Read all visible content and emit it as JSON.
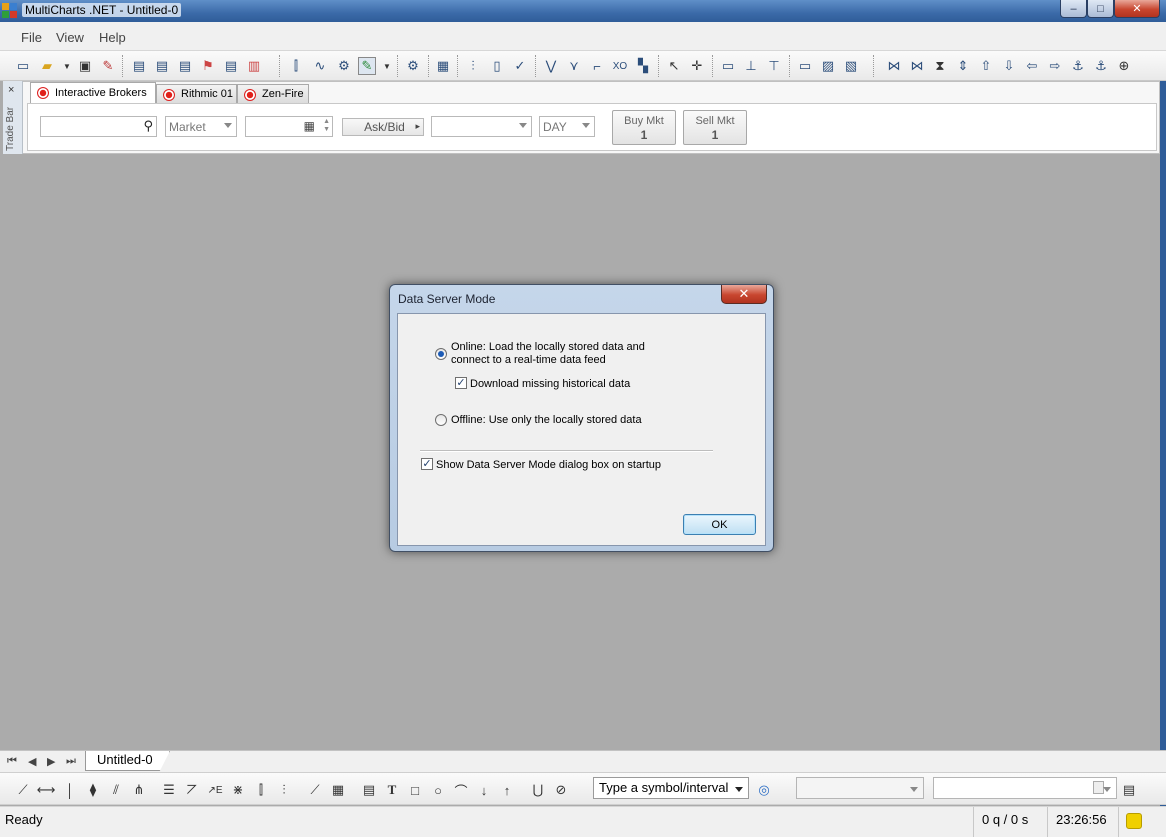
{
  "window": {
    "title": "MultiCharts .NET - Untitled-0",
    "controls": {
      "minimize": "–",
      "maximize": "□",
      "close": "✕"
    }
  },
  "menu": {
    "items": [
      "File",
      "View",
      "Help"
    ]
  },
  "toolbar": {
    "icons": [
      "new-window-icon",
      "open-folder-icon",
      "dropdown-arrow-icon",
      "save-icon",
      "edit-icon",
      "doc-a-icon",
      "doc-b-icon",
      "doc-c-icon",
      "run-icon",
      "doc-d-icon",
      "doc-e-icon",
      "bars-add-icon",
      "bars-curve-icon",
      "bars-settings-icon",
      "pencil-active-icon",
      "dropdown-arrow-icon",
      "formats-icon",
      "calendar-icon",
      "ohlc-icon",
      "candle-icon",
      "checkmark-icon",
      "line-chart-icon",
      "point-figure-icon",
      "step-icon",
      "xo-icon",
      "renko-icon",
      "cursor-icon",
      "crosshair-icon",
      "comment-icon",
      "lower-icon",
      "lift-icon",
      "window-icon",
      "picture-icon",
      "review-icon",
      "first-icon",
      "prev-icon",
      "hourglass-icon",
      "updown-icon",
      "up-icon",
      "down-icon",
      "left-icon",
      "right-icon",
      "anchor-up-icon",
      "anchor-down-icon",
      "zoom-icon"
    ]
  },
  "tradebar": {
    "side_label": "Trade Bar",
    "close": "×",
    "tabs": [
      {
        "label": "Interactive Brokers",
        "active": true
      },
      {
        "label": "Rithmic 01",
        "active": false
      },
      {
        "label": "Zen-Fire",
        "active": false
      }
    ],
    "symbol_value": "",
    "order_type": "Market",
    "quantity_value": "",
    "price_source": "Ask/Bid",
    "account_value": "",
    "tif": "DAY",
    "buy": {
      "label": "Buy Mkt",
      "qty": "1"
    },
    "sell": {
      "label": "Sell Mkt",
      "qty": "1"
    }
  },
  "dialog": {
    "title": "Data Server Mode",
    "close": "✕",
    "online_line1": "Online: Load the locally stored data and",
    "online_line2": "connect to a real-time data feed",
    "online_selected": true,
    "download_label": "Download missing historical data",
    "download_checked": true,
    "offline_label": "Offline: Use only the locally stored data",
    "offline_selected": false,
    "startup_label": "Show Data Server Mode dialog box on startup",
    "startup_checked": true,
    "ok_label": "OK"
  },
  "sheets": {
    "tabs": [
      "Untitled-0"
    ],
    "nav": [
      "⏮",
      "◀",
      "▶",
      "⏭"
    ]
  },
  "drawbar": {
    "symbol_placeholder": "Type a symbol/interval"
  },
  "status": {
    "state": "Ready",
    "quotes": "0 q / 0 s",
    "time": "23:26:56"
  },
  "colors": {
    "workspace": "#ababab",
    "titlebar": "#3b6aa8",
    "radio_dot": "#1d5bb5",
    "status_indicator": "#f0d000"
  }
}
